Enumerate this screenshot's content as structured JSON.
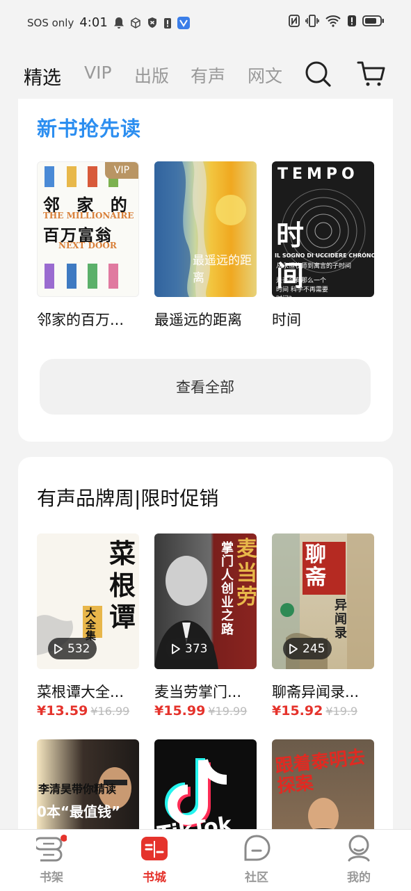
{
  "status_bar": {
    "carrier": "SOS only",
    "time": "4:01"
  },
  "top_nav": {
    "tabs": [
      "精选",
      "VIP",
      "出版",
      "有声",
      "网文"
    ],
    "active_tab": "精选"
  },
  "new_books": {
    "title": "新书抢先读",
    "books": [
      {
        "title": "邻家的百万...",
        "badge": "VIP",
        "cover_title": "邻 家 的",
        "cover_sub_en": "THE MILLIONAIRE",
        "cover_title2": "百万富翁",
        "cover_sub_en2": "NEXT DOOR"
      },
      {
        "title": "最遥远的距离",
        "cover_title": "最遥远的距离"
      },
      {
        "title": "时间",
        "cover_title": "时间",
        "cover_en": "TEMPO",
        "cover_en_sub": "IL SOGNO DI UCCIDERE CHRÓNOS",
        "cover_cn_sub": "从永恒牧师到寓言的子时间",
        "cover_q": "是否会有那么一个时间 科学不再需要时间?"
      }
    ],
    "view_all_label": "查看全部"
  },
  "audio_promo": {
    "title": "有声品牌周|限时促销",
    "books": [
      {
        "title": "菜根谭大全...",
        "plays": "532",
        "price": "¥13.59",
        "original_price": "¥16.99",
        "cover_title": "菜根谭",
        "cover_sub": "大全集"
      },
      {
        "title": "麦当劳掌门...",
        "plays": "373",
        "price": "¥15.99",
        "original_price": "¥19.99",
        "cover_title": "麦当劳",
        "cover_sub": "掌门人创业之路"
      },
      {
        "title": "聊斋异闻录...",
        "plays": "245",
        "price": "¥15.92",
        "original_price": "¥19.9",
        "cover_title": "聊斋",
        "cover_sub": "异闻录"
      }
    ],
    "more_covers": [
      {
        "text1": "李清昊带你精读",
        "text2": "0本“最值钱”"
      },
      {
        "text1": "TikTok"
      },
      {
        "text1": "跟着泰明去探案"
      }
    ]
  },
  "bottom_nav": {
    "items": [
      "书架",
      "书城",
      "社区",
      "我的"
    ],
    "active": "书城"
  },
  "colors": {
    "accent_red": "#e5332c",
    "title_blue": "#2c8ef0",
    "vip_gold": "#b99564"
  }
}
